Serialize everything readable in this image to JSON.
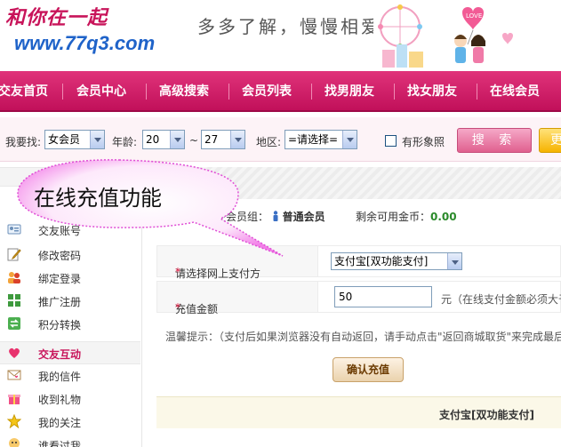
{
  "logo": {
    "chinese": "和你在一起",
    "url": "www.77q3.com"
  },
  "slogan": "多多了解，慢慢相爱",
  "banner": {
    "love_text": "LOVE"
  },
  "nav": {
    "items": [
      "交友首页",
      "会员中心",
      "高级搜索",
      "会员列表",
      "找男朋友",
      "找女朋友",
      "在线会员"
    ]
  },
  "search": {
    "find_label": "我要找:",
    "gender_value": "女会员",
    "age_label": "年龄:",
    "age_from": "20",
    "age_sep": "~",
    "age_to": "27",
    "region_label": "地区:",
    "region_value": "=请选择=",
    "photo_label": "有形象照",
    "search_button": "搜 索",
    "more_button": "更"
  },
  "sidebar": {
    "items": [
      {
        "label": "交友账号",
        "icon": "user-card-icon"
      },
      {
        "label": "修改密码",
        "icon": "pencil-icon"
      },
      {
        "label": "绑定登录",
        "icon": "users-icon"
      },
      {
        "label": "推广注册",
        "icon": "grid-icon"
      },
      {
        "label": "积分转换",
        "icon": "transfer-icon"
      }
    ],
    "section": {
      "label": "交友互动",
      "icon": "heart-icon"
    },
    "items2": [
      {
        "label": "我的信件",
        "icon": "mail-icon"
      },
      {
        "label": "收到礼物",
        "icon": "gift-icon"
      },
      {
        "label": "我的关注",
        "icon": "star-icon"
      },
      {
        "label": "谁看过我",
        "icon": "eye-icon"
      }
    ]
  },
  "account": {
    "group_label": "所在会员组：",
    "group_value": "普通会员",
    "gold_label": "剩余可用金币：",
    "gold_value": "0.00"
  },
  "form": {
    "pay_label": "请选择网上支付方",
    "pay_value": "支付宝[双功能支付]",
    "amount_label": "充值金额",
    "amount_value": "50",
    "amount_unit": "元（在线支付金额必须大于",
    "tip": "温馨提示：（支付后如果浏览器没有自动返回，请手动点击\"返回商城取货\"来完成最后",
    "confirm_button": "确认充值",
    "method_footer": "支付宝[双功能支付]"
  },
  "callout": {
    "text": "在线充值功能"
  },
  "colors": {
    "brand": "#c8145a",
    "nav_bg": "#d11f6b",
    "link_blue": "#1f63c9",
    "gold_green": "#2a8a2a"
  }
}
